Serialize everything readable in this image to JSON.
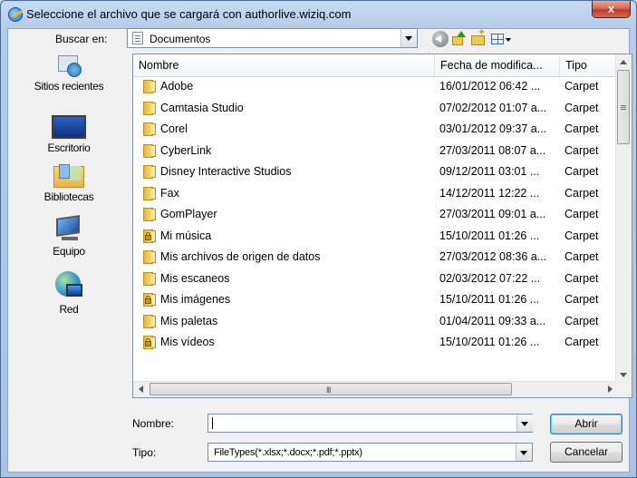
{
  "window": {
    "title": "Seleccione el archivo que se cargará con authorlive.wiziq.com",
    "close_label": "x"
  },
  "lookin": {
    "label": "Buscar en:",
    "value": "Documentos"
  },
  "places": [
    {
      "label": "Sitios recientes",
      "icon": "recent-places-icon"
    },
    {
      "label": "Escritorio",
      "icon": "desktop-icon"
    },
    {
      "label": "Bibliotecas",
      "icon": "libraries-icon"
    },
    {
      "label": "Equipo",
      "icon": "computer-icon"
    },
    {
      "label": "Red",
      "icon": "network-icon"
    }
  ],
  "columns": {
    "name": "Nombre",
    "date": "Fecha de modifica...",
    "type": "Tipo"
  },
  "files": [
    {
      "name": "Adobe",
      "date": "16/01/2012 06:42 ...",
      "type": "Carpet",
      "icon": "folder-icon"
    },
    {
      "name": "Camtasia Studio",
      "date": "07/02/2012 01:07 a...",
      "type": "Carpet",
      "icon": "folder-icon"
    },
    {
      "name": "Corel",
      "date": "03/01/2012 09:37 a...",
      "type": "Carpet",
      "icon": "folder-icon"
    },
    {
      "name": "CyberLink",
      "date": "27/03/2011 08:07 a...",
      "type": "Carpet",
      "icon": "folder-icon"
    },
    {
      "name": "Disney Interactive Studios",
      "date": "09/12/2011 03:01 ...",
      "type": "Carpet",
      "icon": "folder-icon"
    },
    {
      "name": "Fax",
      "date": "14/12/2011 12:22 ...",
      "type": "Carpet",
      "icon": "folder-icon"
    },
    {
      "name": "GomPlayer",
      "date": "27/03/2011 09:01 a...",
      "type": "Carpet",
      "icon": "folder-icon"
    },
    {
      "name": "Mi música",
      "date": "15/10/2011 01:26 ...",
      "type": "Carpet",
      "icon": "locked-folder-icon"
    },
    {
      "name": "Mis archivos de origen de datos",
      "date": "27/03/2012 08:36 a...",
      "type": "Carpet",
      "icon": "folder-icon"
    },
    {
      "name": "Mis escaneos",
      "date": "02/03/2012 07:22 ...",
      "type": "Carpet",
      "icon": "folder-icon"
    },
    {
      "name": "Mis imágenes",
      "date": "15/10/2011 01:26 ...",
      "type": "Carpet",
      "icon": "locked-folder-icon"
    },
    {
      "name": "Mis paletas",
      "date": "01/04/2011 09:33 a...",
      "type": "Carpet",
      "icon": "folder-icon"
    },
    {
      "name": "Mis vídeos",
      "date": "15/10/2011 01:26 ...",
      "type": "Carpet",
      "icon": "locked-folder-icon"
    }
  ],
  "hscroll": {
    "grip": "III"
  },
  "form": {
    "name_label": "Nombre:",
    "name_value": "",
    "type_label": "Tipo:",
    "type_value": "FileTypes(*.xlsx;*.docx;*.pdf;*.pptx)"
  },
  "buttons": {
    "open": "Abrir",
    "cancel": "Cancelar"
  }
}
